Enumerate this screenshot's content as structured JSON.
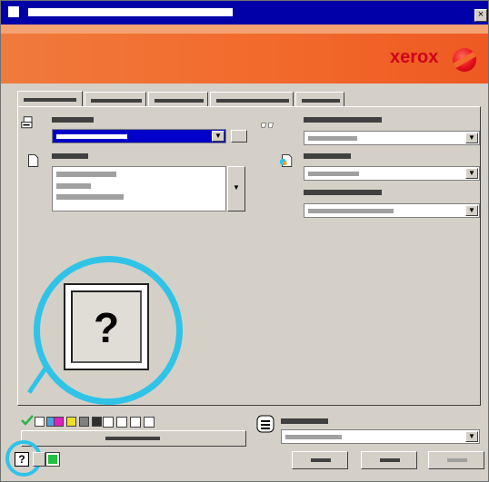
{
  "window": {
    "close_label": "×"
  },
  "banner": {
    "brand": "xerox"
  },
  "help": {
    "key_label": "?",
    "small_label": "?"
  },
  "colors": {
    "title_bar": "#0000a8",
    "banner": "#f26a2c",
    "brand_red": "#d0021b",
    "callout": "#2fc3e8",
    "selection": "#0000c8"
  },
  "icons": [
    "paper-icon",
    "document-icon",
    "paper-tray-icon",
    "color-icon",
    "check-icon",
    "layout-icon",
    "help-icon"
  ]
}
